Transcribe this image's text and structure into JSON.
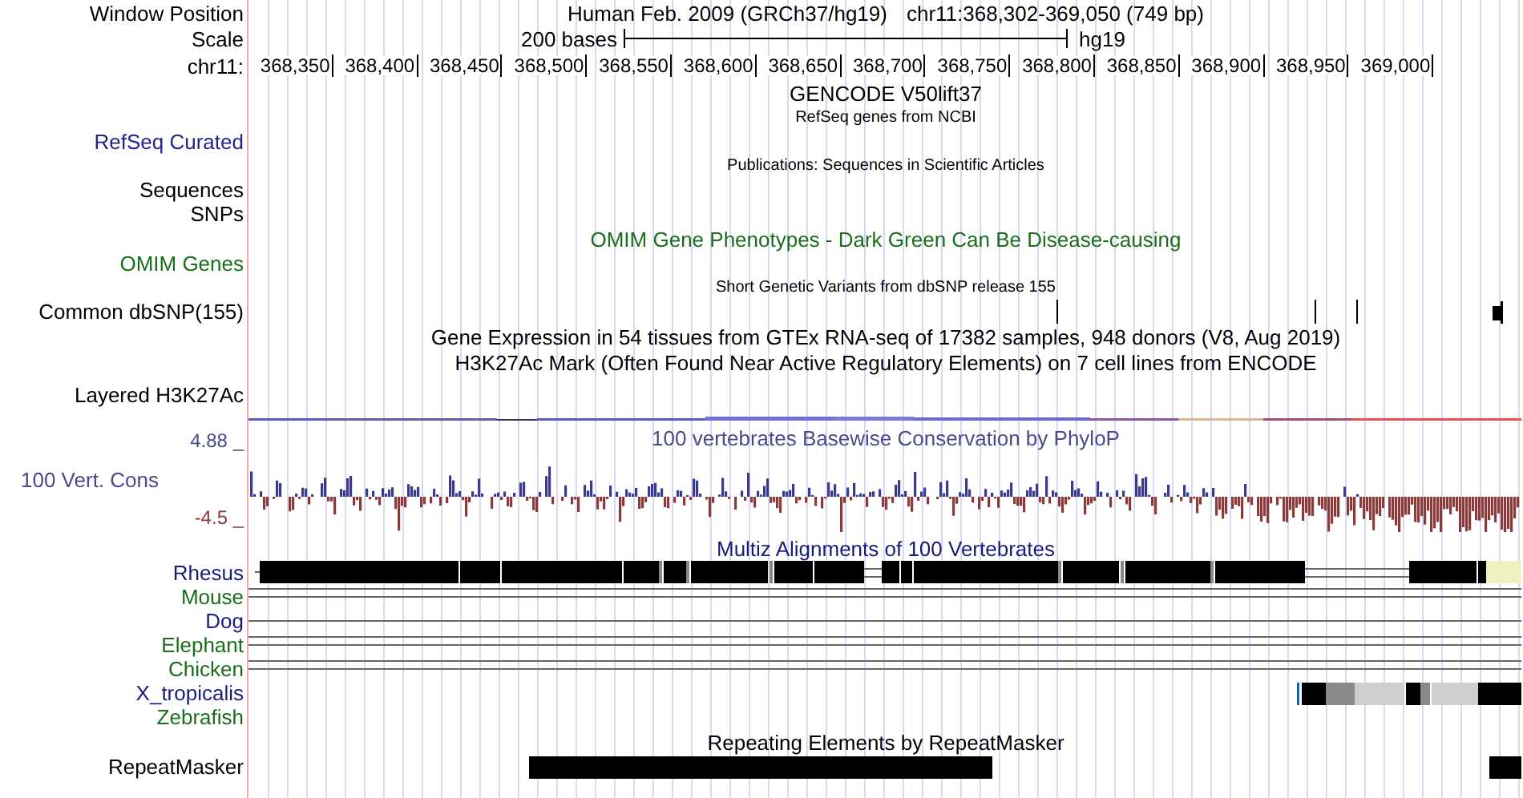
{
  "header": {
    "position_label": "Window Position",
    "assembly_text": "Human Feb. 2009 (GRCh37/hg19)",
    "position_text": "chr11:368,302-369,050 (749 bp)"
  },
  "scale": {
    "label": "Scale",
    "bar_text": "200 bases",
    "assembly": "hg19"
  },
  "ruler": {
    "label": "chr11:",
    "ticks": [
      "368,350",
      "368,400",
      "368,450",
      "368,500",
      "368,550",
      "368,600",
      "368,650",
      "368,700",
      "368,750",
      "368,800",
      "368,850",
      "368,900",
      "368,950",
      "369,000"
    ]
  },
  "rows": [
    {
      "kind": "title",
      "text": "GENCODE V50lift37",
      "color": "#000000"
    },
    {
      "kind": "caption",
      "text": "RefSeq genes from NCBI",
      "color": "#000000"
    },
    {
      "kind": "label",
      "label": "RefSeq Curated",
      "color": "#23238e"
    },
    {
      "kind": "caption",
      "text": "Publications: Sequences in Scientific Articles",
      "color": "#000000"
    },
    {
      "kind": "label",
      "label": "Sequences",
      "color": "#000000"
    },
    {
      "kind": "label",
      "label": "SNPs",
      "color": "#000000"
    },
    {
      "kind": "title",
      "text": "OMIM Gene Phenotypes - Dark Green Can Be Disease-causing",
      "color": "#1a6e1a"
    },
    {
      "kind": "label",
      "label": "OMIM Genes",
      "color": "#1a6e1a"
    },
    {
      "kind": "caption",
      "text": "Short Genetic Variants from dbSNP release 155",
      "color": "#000000"
    },
    {
      "kind": "variants",
      "label": "Common dbSNP(155)",
      "color": "#000000"
    },
    {
      "kind": "title",
      "text": "Gene Expression in 54 tissues from GTEx RNA-seq of 17382 samples, 948 donors (V8, Aug 2019)",
      "color": "#000000"
    },
    {
      "kind": "title",
      "text": "H3K27Ac Mark (Often Found Near Active Regulatory Elements) on 7 cell lines from ENCODE",
      "color": "#000000"
    },
    {
      "kind": "layered",
      "label": "Layered H3K27Ac",
      "color": "#000000"
    },
    {
      "kind": "wiggle",
      "label": "100 Vert. Cons",
      "max_label": "4.88 _",
      "min_label": "-4.5 _",
      "text": "100 vertebrates Basewise Conservation by PhyloP"
    },
    {
      "kind": "title",
      "text": "Multiz Alignments of 100 Vertebrates",
      "color": "#1a1a7a"
    },
    {
      "kind": "alignments",
      "species": [
        {
          "kind": "blocks",
          "label": "Rhesus",
          "color": "#1a1a7a"
        },
        {
          "kind": "double-line",
          "label": "Mouse",
          "color": "#1a6e1a"
        },
        {
          "kind": "single-line",
          "label": "Dog",
          "color": "#1a1a7a"
        },
        {
          "kind": "double-line",
          "label": "Elephant",
          "color": "#1a6e1a"
        },
        {
          "kind": "double-line",
          "label": "Chicken",
          "color": "#1a6e1a"
        },
        {
          "kind": "partial-blocks",
          "label": "X_tropicalis",
          "color": "#1a1a7a"
        },
        {
          "kind": "empty",
          "label": "Zebrafish",
          "color": "#1a6e1a"
        }
      ]
    },
    {
      "kind": "title",
      "text": "Repeating Elements by RepeatMasker",
      "color": "#000000"
    },
    {
      "kind": "repeats",
      "label": "RepeatMasker",
      "color": "#000000"
    }
  ]
}
